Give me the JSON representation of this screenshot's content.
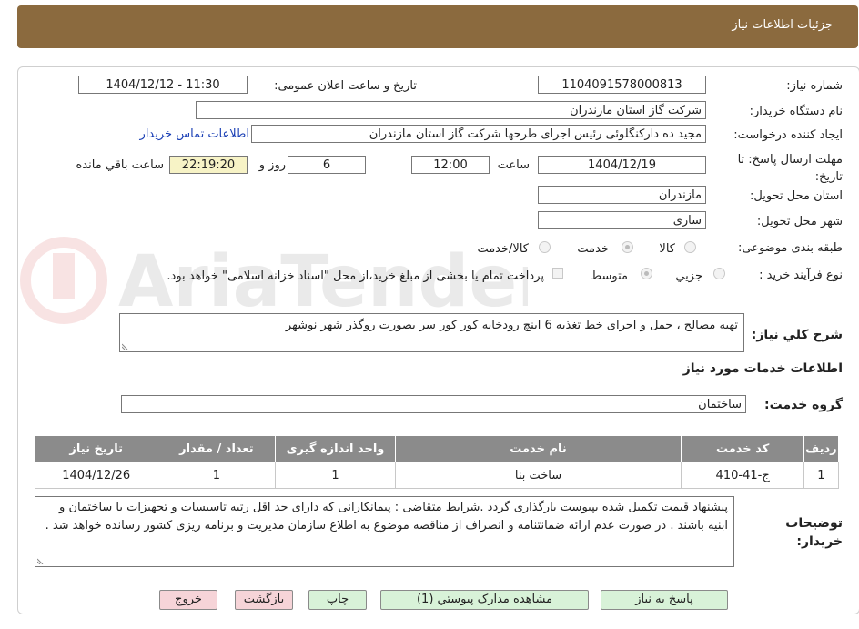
{
  "header": {
    "title": "جزئیات اطلاعات نیاز"
  },
  "form": {
    "need_number": {
      "label": "شماره نیاز:",
      "value": "1104091578000813"
    },
    "announce_datetime": {
      "label": "تاریخ و ساعت اعلان عمومی:",
      "value": "1404/12/12 - 11:30"
    },
    "buyer_org": {
      "label": "نام دستگاه خریدار:",
      "value": "شرکت گاز استان مازندران"
    },
    "requester": {
      "label": "ایجاد کننده درخواست:",
      "value": "مجید ده دارکنگلوئی رئیس اجرای طرحها شرکت گاز استان مازندران"
    },
    "buyer_contact_link": "اطلاعات تماس خریدار",
    "deadline": {
      "label": "مهلت ارسال پاسخ: تا تاریخ:",
      "date": "1404/12/19",
      "time_label": "ساعت",
      "time": "12:00",
      "days": "6",
      "days_label": "روز و",
      "remaining": "22:19:20",
      "remaining_label": "ساعت باقي مانده"
    },
    "delivery_province": {
      "label": "استان محل تحویل:",
      "value": "مازندران"
    },
    "delivery_city": {
      "label": "شهر محل تحویل:",
      "value": "ساری"
    },
    "category": {
      "label": "طبقه بندی موضوعی:",
      "options": [
        "کالا",
        "خدمت",
        "کالا/خدمت"
      ],
      "selected": "خدمت"
    },
    "purchase_type": {
      "label": "نوع فرآیند خرید :",
      "options": [
        "جزیي",
        "متوسط"
      ],
      "selected": "متوسط",
      "note": "پرداخت تمام یا بخشی از مبلغ خرید،از محل \"اسناد خزانه اسلامی\" خواهد بود."
    },
    "description": {
      "label": "شرح کلي نیاز:",
      "value": "تهیه مصالح ، حمل و اجرای خط تغذیه 6 اینچ رودخانه کور کور سر بصورت روگذر شهر نوشهر"
    }
  },
  "services": {
    "section_title": "اطلاعات خدمات مورد نیاز",
    "group_label": "گروه خدمت:",
    "group_value": "ساختمان",
    "columns": [
      "ردیف",
      "کد خدمت",
      "نام خدمت",
      "واحد اندازه گیری",
      "تعداد / مقدار",
      "تاریخ نیاز"
    ],
    "rows": [
      [
        "1",
        "ج-41-410",
        "ساخت بنا",
        "1",
        "1",
        "1404/12/26"
      ]
    ]
  },
  "buyer_notes": {
    "label": "توضیحات خریدار:",
    "value": "پیشنهاد قیمت تکمیل شده بپیوست بارگذاری گردد .شرایط متقاضی : پیمانکارانی که دارای حد اقل رتبه تاسیسات و تجهیزات یا ساختمان و ابنیه باشند . در صورت عدم ارائه ضمانتنامه و انصراف از مناقصه موضوع به اطلاع سازمان مدیریت و برنامه ریزی کشور رسانده خواهد شد ."
  },
  "buttons": {
    "reply": "پاسخ به نیاز",
    "attachments": "مشاهده مدارک پیوستي (1)",
    "print": "چاپ",
    "back": "بازگشت",
    "exit": "خروج"
  },
  "watermark_text": "AriaTender.neT",
  "colors": {
    "header": "#8b6a3e",
    "table_header": "#8b8b8b",
    "highlight": "#f7f3c6",
    "link": "#1a3fb5"
  }
}
